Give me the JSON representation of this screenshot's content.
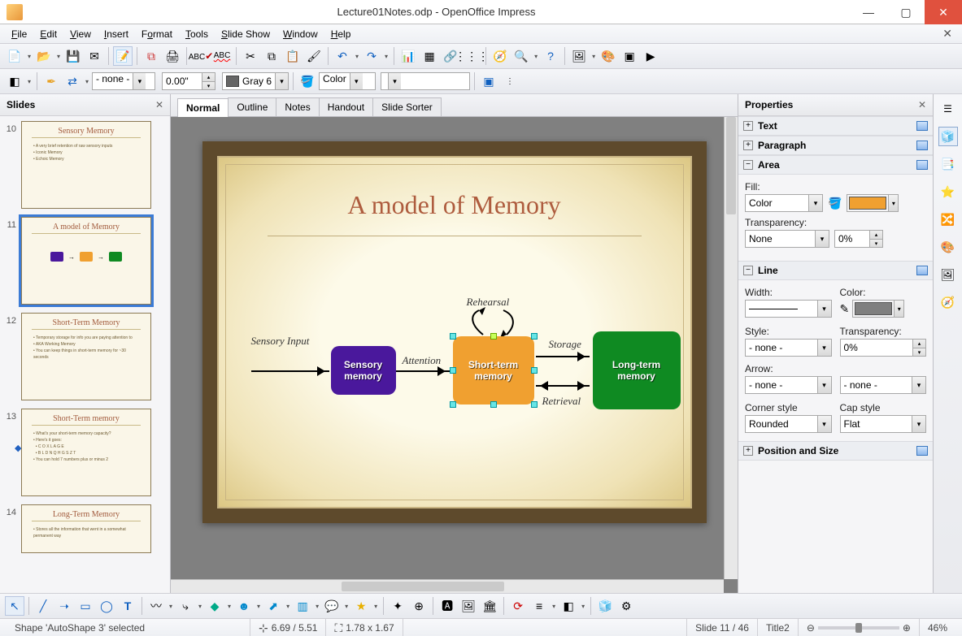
{
  "window": {
    "title": "Lecture01Notes.odp - OpenOffice Impress"
  },
  "menu": {
    "file": "File",
    "edit": "Edit",
    "view": "View",
    "insert": "Insert",
    "format": "Format",
    "tools": "Tools",
    "slideshow": "Slide Show",
    "window": "Window",
    "help": "Help"
  },
  "toolbar2": {
    "line_style": "- none -",
    "line_width": "0.00\"",
    "line_color_name": "Gray 6",
    "area_type": "Color"
  },
  "slides_panel": {
    "title": "Slides"
  },
  "slides": [
    {
      "num": "10",
      "title": "Sensory Memory",
      "type": "bullets"
    },
    {
      "num": "11",
      "title": "A model of Memory",
      "type": "diagram",
      "selected": true
    },
    {
      "num": "12",
      "title": "Short-Term Memory",
      "type": "bullets"
    },
    {
      "num": "13",
      "title": "Short-Term memory",
      "type": "bullets"
    },
    {
      "num": "14",
      "title": "Long-Term Memory",
      "type": "bullets"
    }
  ],
  "view_tabs": {
    "normal": "Normal",
    "outline": "Outline",
    "notes": "Notes",
    "handout": "Handout",
    "sorter": "Slide Sorter"
  },
  "slide_content": {
    "title": "A model of Memory",
    "labels": {
      "sensory_input": "Sensory Input",
      "attention": "Attention",
      "rehearsal": "Rehearsal",
      "storage": "Storage",
      "retrieval": "Retrieval"
    },
    "boxes": {
      "sensory": "Sensory memory",
      "short": "Short-term memory",
      "long": "Long-term memory"
    }
  },
  "props": {
    "title": "Properties",
    "sections": {
      "text": "Text",
      "paragraph": "Paragraph",
      "area": "Area",
      "line": "Line",
      "pos": "Position and Size"
    },
    "area": {
      "fill_label": "Fill:",
      "fill_type": "Color",
      "fill_color": "#f0a030",
      "transparency_label": "Transparency:",
      "transparency_type": "None",
      "transparency_value": "0%"
    },
    "line": {
      "width_label": "Width:",
      "color_label": "Color:",
      "line_color": "#7f7f7f",
      "style_label": "Style:",
      "style": "- none -",
      "ltrans_label": "Transparency:",
      "ltrans": "0%",
      "arrow_label": "Arrow:",
      "arrow_start": "- none -",
      "arrow_end": "- none -",
      "corner_label": "Corner style",
      "corner": "Rounded",
      "cap_label": "Cap style",
      "cap": "Flat"
    }
  },
  "status": {
    "selection": "Shape 'AutoShape 3' selected",
    "pos": "6.69 / 5.51",
    "size": "1.78 x 1.67",
    "slide": "Slide 11 / 46",
    "template": "Title2",
    "zoom": "46%"
  }
}
